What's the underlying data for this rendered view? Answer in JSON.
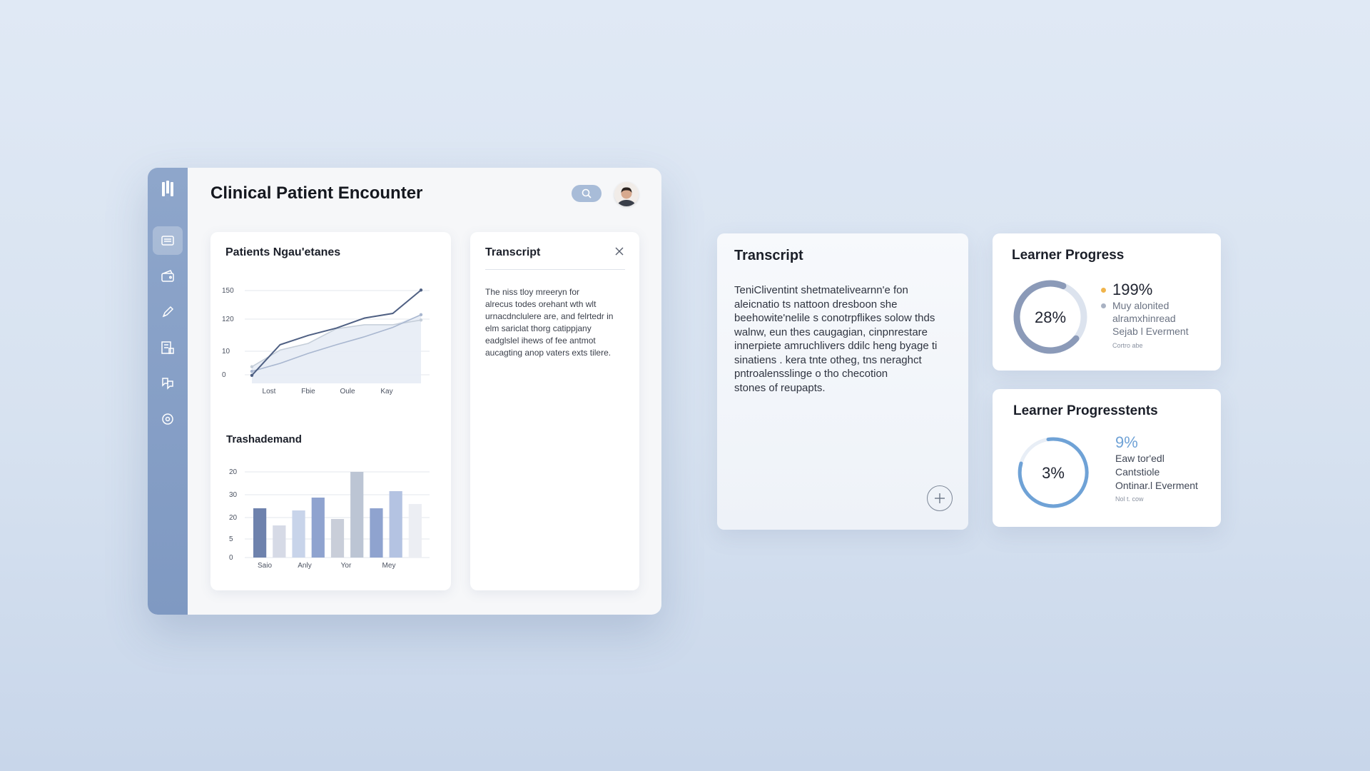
{
  "app": {
    "title": "Clinical Patient Encounter",
    "sidebar": {
      "icons": [
        "logo-icon",
        "dashboard-icon",
        "wallet-icon",
        "pen-icon",
        "building-icon",
        "chat-icon",
        "search-icon"
      ],
      "active_index": 0
    },
    "header": {
      "search_icon": "search-icon",
      "avatar": "user-avatar"
    }
  },
  "chart_card": {
    "line_title": "Patients Ngau'etanes",
    "bar_title": "Trashademand"
  },
  "transcript_card": {
    "title": "Transcript",
    "lines": [
      "The niss tloy mreeryn for",
      "alrecus todes orehant wth wlt",
      "urnacdnclulere are, and felrtedr in",
      "elm sariclat thorg catippjany",
      "eadglslel ihews of fee antmot",
      "aucagting anop vaters exts tilere."
    ]
  },
  "big_transcript": {
    "title": "Transcript",
    "lines": [
      "TeniCliventint shetmatelivearnn'e fon",
      "aleicnatio ts nattoon dresboon she",
      "beehowite'nelile s conotrpflikes solow thds",
      "walnw, eun thes caugagian, cinpnrestare",
      "innerpiete amruchlivers ddilc heng byage ti",
      "sinatiens . kera tnte otheg, tns neraghct",
      "pntroalensslinge o tho checotion",
      "stones of reupapts."
    ]
  },
  "learner_progress": {
    "title": "Learner Progress",
    "donut_label": "28%",
    "donut_fraction": 0.28,
    "stat": "199%",
    "line1": "Muy alonited",
    "line2": "alramxhinread",
    "line3": "Sejab l Everment",
    "small": "Cortro abe",
    "colors": {
      "ring": "#8b9ab8",
      "track": "#dce3ee",
      "dot_main": "#f0b44c",
      "dot_sub": "#a9b2c3"
    }
  },
  "learner_progress_2": {
    "title": "Learner Progresstents",
    "donut_label": "3%",
    "donut_fraction": 0.03,
    "stat": "9%",
    "line1": "Eaw tor'edl",
    "line2": "Cantstiole",
    "line3": "Ontinar.l Everment",
    "small": "Nol t. cow",
    "colors": {
      "ring": "#6fa2d6",
      "accent": "#6fa2d6"
    }
  },
  "chart_data": [
    {
      "type": "line",
      "title": "Patients Ngau'etanes",
      "categories": [
        "Lost",
        "Fbie",
        "Oule",
        "Kay"
      ],
      "y_ticks": [
        "150",
        "120",
        "10",
        "0"
      ],
      "x_ticks": [
        "Lost",
        "Fbie",
        "Oule",
        "Kay"
      ],
      "series": [
        {
          "values": [
            12,
            58,
            72,
            83,
            98,
            105,
            140
          ]
        },
        {
          "values": [
            25,
            50,
            60,
            82,
            88,
            88,
            95
          ]
        },
        {
          "values": [
            18,
            30,
            45,
            58,
            70,
            84,
            103
          ]
        }
      ],
      "x": [
        0,
        1,
        2,
        3,
        4,
        5,
        6
      ],
      "ylim": [
        0,
        150
      ],
      "grid": true,
      "colors": [
        "#4f6083",
        "#c5ced9",
        "#a9b7d0"
      ]
    },
    {
      "type": "bar",
      "title": "Trashademand",
      "categories": [
        "Saio",
        "Anly",
        "Yor",
        "Mey"
      ],
      "y_ticks": [
        "20",
        "30",
        "20",
        "5",
        "0"
      ],
      "x_ticks": [
        "Saio",
        "Anly",
        "Yor",
        "Mey"
      ],
      "values": [
        23,
        15,
        22,
        28,
        18,
        40,
        23,
        31,
        25
      ],
      "ylim": [
        0,
        40
      ],
      "grid": true,
      "colors": [
        "#6e82ad",
        "#d6dae6",
        "#c8d4ea",
        "#8fa3cf",
        "#c9ced9",
        "#bcc5d4",
        "#8fa3cf",
        "#b4c3e2",
        "#eceef3"
      ]
    }
  ]
}
